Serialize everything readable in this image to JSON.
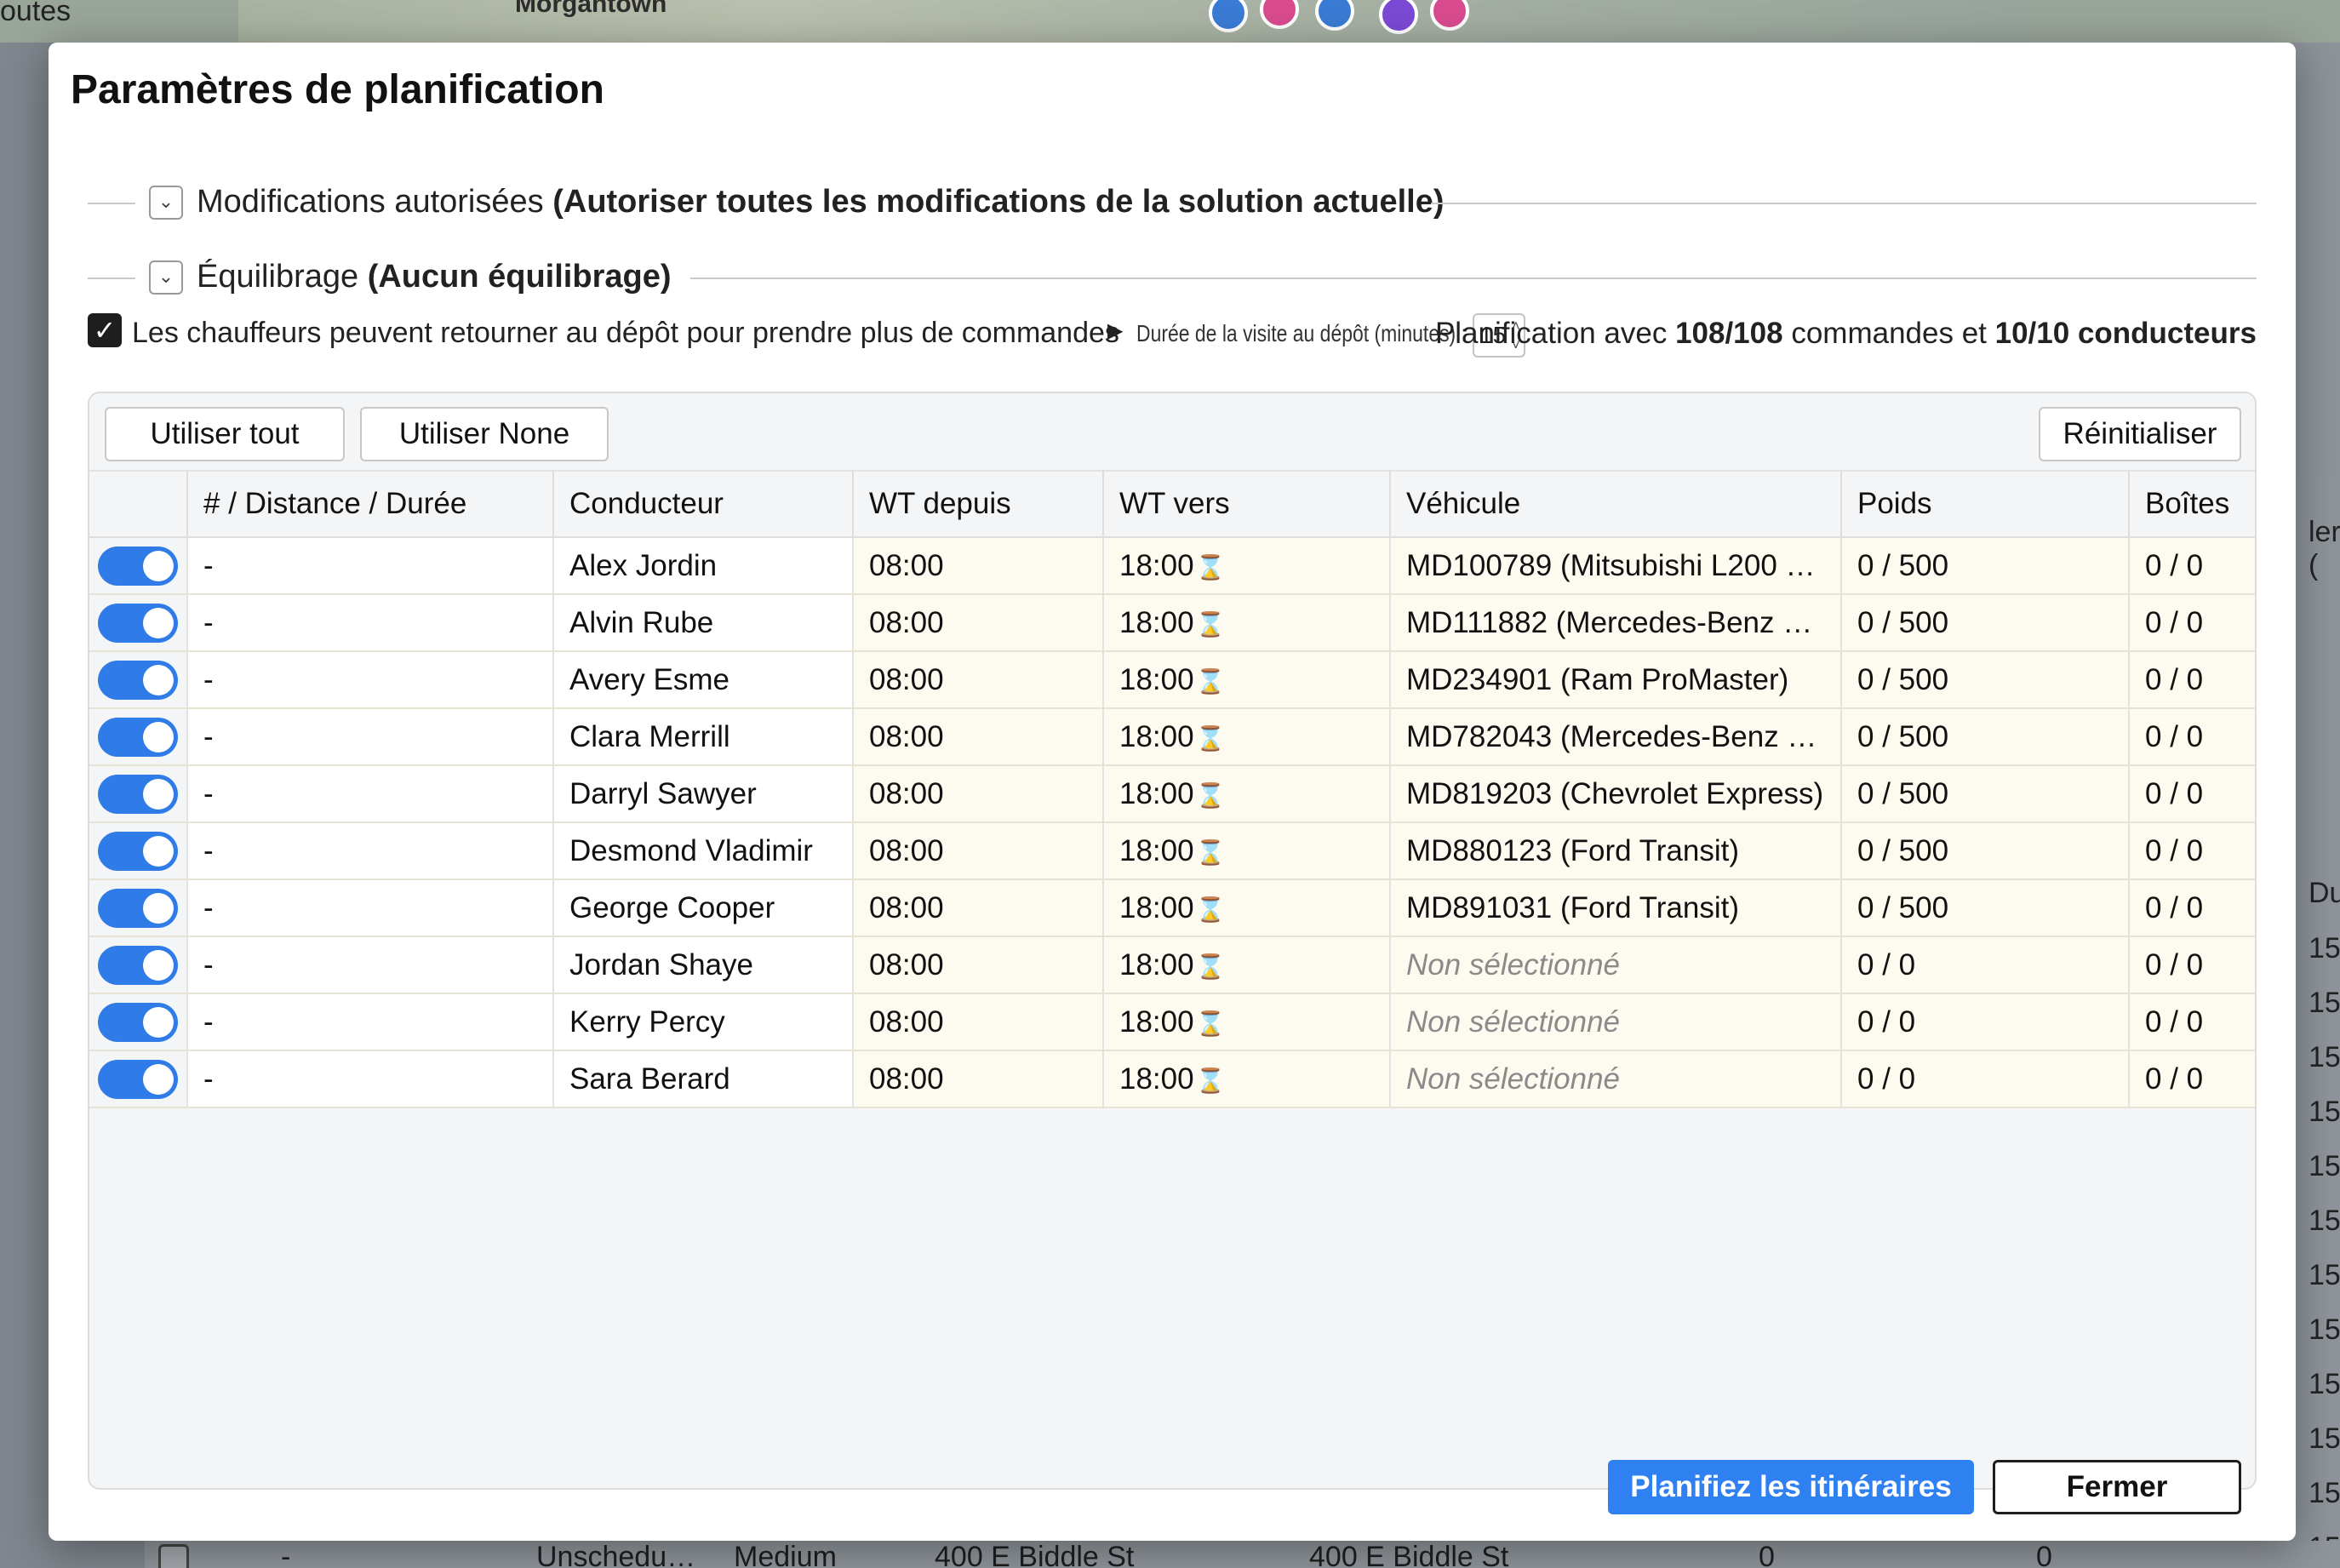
{
  "background": {
    "left_text": "outes",
    "map_label": "Morgantown",
    "right_numbers": [
      "15",
      "15",
      "15",
      "15",
      "15",
      "15",
      "15",
      "15",
      "15",
      "15",
      "15",
      "15"
    ],
    "right_header": "Du",
    "right_partial": "ler (",
    "bottom_row": [
      "-",
      "Unschedu…",
      "Medium",
      "400 E Biddle St",
      "400 E Biddle St",
      "0",
      "0"
    ]
  },
  "modal": {
    "title": "Paramètres de planification",
    "sections": {
      "modifications_label": "Modifications autorisées",
      "modifications_value": "(Autoriser toutes les modifications de la solution actuelle)",
      "balancing_label": "Équilibrage",
      "balancing_value": "(Aucun équilibrage)"
    },
    "options": {
      "return_to_depot_label": "Les chauffeurs peuvent retourner au dépôt pour prendre plus de commandes",
      "return_to_depot_checked": true,
      "depot_visit_label": "Durée de la visite au dépôt (minutes) :",
      "depot_visit_value": "15",
      "planning_prefix": "Planification avec",
      "orders_count": "108/108",
      "orders_word": "commandes et",
      "drivers_count": "10/10",
      "drivers_word": "conducteurs"
    },
    "toolbar": {
      "use_all": "Utiliser tout",
      "use_none": "Utiliser None",
      "reset": "Réinitialiser"
    },
    "table": {
      "columns": [
        "# / Distance / Durée",
        "Conducteur",
        "WT depuis",
        "WT vers",
        "Véhicule",
        "Poids",
        "Boîtes"
      ],
      "rows": [
        {
          "enabled": true,
          "distance": "-",
          "driver": "Alex Jordin",
          "from": "08:00",
          "to": "18:00",
          "vehicle": "MD100789 (Mitsubishi L200 …",
          "weight": "0 / 500",
          "boxes": "0 / 0"
        },
        {
          "enabled": true,
          "distance": "-",
          "driver": "Alvin Rube",
          "from": "08:00",
          "to": "18:00",
          "vehicle": "MD111882 (Mercedes-Benz …",
          "weight": "0 / 500",
          "boxes": "0 / 0"
        },
        {
          "enabled": true,
          "distance": "-",
          "driver": "Avery Esme",
          "from": "08:00",
          "to": "18:00",
          "vehicle": "MD234901 (Ram ProMaster)",
          "weight": "0 / 500",
          "boxes": "0 / 0"
        },
        {
          "enabled": true,
          "distance": "-",
          "driver": "Clara Merrill",
          "from": "08:00",
          "to": "18:00",
          "vehicle": "MD782043 (Mercedes-Benz …",
          "weight": "0 / 500",
          "boxes": "0 / 0"
        },
        {
          "enabled": true,
          "distance": "-",
          "driver": "Darryl Sawyer",
          "from": "08:00",
          "to": "18:00",
          "vehicle": "MD819203 (Chevrolet Express)",
          "weight": "0 / 500",
          "boxes": "0 / 0"
        },
        {
          "enabled": true,
          "distance": "-",
          "driver": "Desmond Vladimir",
          "from": "08:00",
          "to": "18:00",
          "vehicle": "MD880123 (Ford Transit)",
          "weight": "0 / 500",
          "boxes": "0 / 0"
        },
        {
          "enabled": true,
          "distance": "-",
          "driver": "George Cooper",
          "from": "08:00",
          "to": "18:00",
          "vehicle": "MD891031 (Ford Transit)",
          "weight": "0 / 500",
          "boxes": "0 / 0"
        },
        {
          "enabled": true,
          "distance": "-",
          "driver": "Jordan Shaye",
          "from": "08:00",
          "to": "18:00",
          "vehicle": "Non sélectionné",
          "vehicle_unselected": true,
          "weight": "0 / 0",
          "boxes": "0 / 0"
        },
        {
          "enabled": true,
          "distance": "-",
          "driver": "Kerry Percy",
          "from": "08:00",
          "to": "18:00",
          "vehicle": "Non sélectionné",
          "vehicle_unselected": true,
          "weight": "0 / 0",
          "boxes": "0 / 0"
        },
        {
          "enabled": true,
          "distance": "-",
          "driver": "Sara Berard",
          "from": "08:00",
          "to": "18:00",
          "vehicle": "Non sélectionné",
          "vehicle_unselected": true,
          "weight": "0 / 0",
          "boxes": "0 / 0"
        }
      ]
    },
    "footer": {
      "plan_button": "Planifiez les itinéraires",
      "close_button": "Fermer"
    }
  },
  "colors": {
    "accent": "#2f80f0",
    "switch_on": "#2f7be8",
    "row_cream": "#fdfaf0"
  }
}
